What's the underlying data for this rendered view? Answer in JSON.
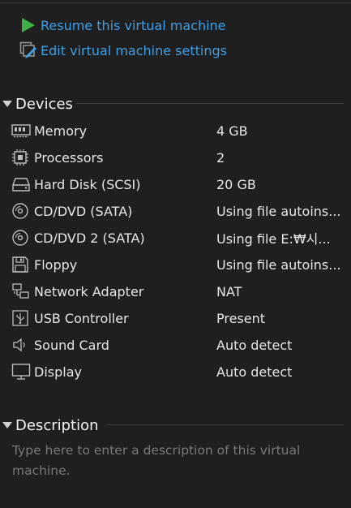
{
  "actions": {
    "resume_label": "Resume this virtual machine",
    "edit_label": "Edit virtual machine settings"
  },
  "sections": {
    "devices_title": "Devices",
    "description_title": "Description"
  },
  "devices": [
    {
      "name": "Memory",
      "value": "4 GB",
      "icon": "memory-icon"
    },
    {
      "name": "Processors",
      "value": "2",
      "icon": "processor-icon"
    },
    {
      "name": "Hard Disk (SCSI)",
      "value": "20 GB",
      "icon": "hard-disk-icon"
    },
    {
      "name": "CD/DVD (SATA)",
      "value": "Using file autoins...",
      "icon": "cd-dvd-icon"
    },
    {
      "name": "CD/DVD 2 (SATA)",
      "value": "Using file E:₩시...",
      "icon": "cd-dvd-icon"
    },
    {
      "name": "Floppy",
      "value": "Using file autoins...",
      "icon": "floppy-icon"
    },
    {
      "name": "Network Adapter",
      "value": "NAT",
      "icon": "network-adapter-icon"
    },
    {
      "name": "USB Controller",
      "value": "Present",
      "icon": "usb-controller-icon"
    },
    {
      "name": "Sound Card",
      "value": "Auto detect",
      "icon": "sound-card-icon"
    },
    {
      "name": "Display",
      "value": "Auto detect",
      "icon": "display-icon"
    }
  ],
  "description": {
    "placeholder": "Type here to enter a description of this virtual machine."
  },
  "colors": {
    "background": "#1f1f1f",
    "link": "#3f9ee4",
    "play": "#3cb043",
    "text": "#e6e6e6",
    "muted": "#7a7a7a"
  }
}
